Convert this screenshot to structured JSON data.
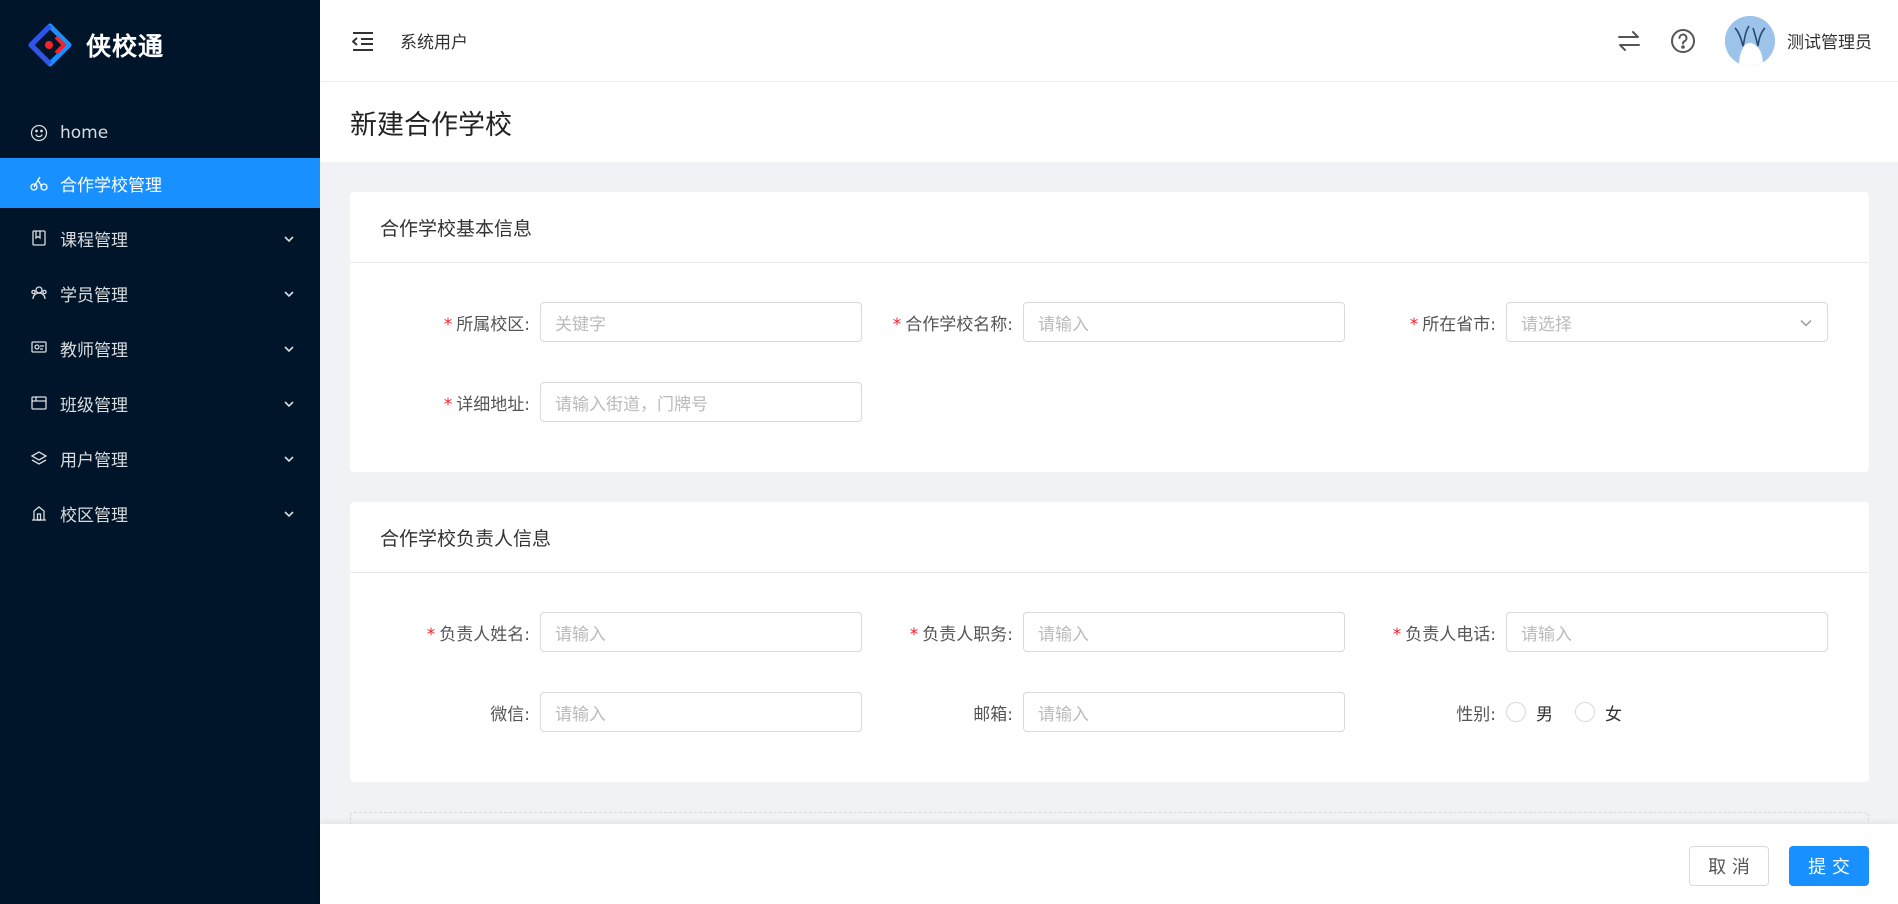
{
  "app": {
    "name": "侠校通"
  },
  "sidebar": {
    "items": [
      {
        "label": "home",
        "icon": "smile-icon",
        "active": false,
        "has_arrow": false
      },
      {
        "label": "合作学校管理",
        "icon": "bike-icon",
        "active": true,
        "has_arrow": false
      },
      {
        "label": "课程管理",
        "icon": "book-icon",
        "active": false,
        "has_arrow": true
      },
      {
        "label": "学员管理",
        "icon": "team-icon",
        "active": false,
        "has_arrow": true
      },
      {
        "label": "教师管理",
        "icon": "teacher-icon",
        "active": false,
        "has_arrow": true
      },
      {
        "label": "班级管理",
        "icon": "class-icon",
        "active": false,
        "has_arrow": true
      },
      {
        "label": "用户管理",
        "icon": "user-stack-icon",
        "active": false,
        "has_arrow": true
      },
      {
        "label": "校区管理",
        "icon": "campus-icon",
        "active": false,
        "has_arrow": true
      }
    ]
  },
  "header": {
    "title": "系统用户",
    "user_name": "测试管理员"
  },
  "page": {
    "title": "新建合作学校"
  },
  "section_basic": {
    "title": "合作学校基本信息",
    "fields": {
      "campus": {
        "label": "所属校区:",
        "placeholder": "关键字",
        "required": true
      },
      "school_name": {
        "label": "合作学校名称:",
        "placeholder": "请输入",
        "required": true
      },
      "province_city": {
        "label": "所在省市:",
        "placeholder": "请选择",
        "required": true
      },
      "address": {
        "label": "详细地址:",
        "placeholder": "请输入街道，门牌号",
        "required": true
      }
    }
  },
  "section_contact": {
    "title": "合作学校负责人信息",
    "fields": {
      "contact_name": {
        "label": "负责人姓名:",
        "placeholder": "请输入",
        "required": true
      },
      "contact_title": {
        "label": "负责人职务:",
        "placeholder": "请输入",
        "required": true
      },
      "contact_phone": {
        "label": "负责人电话:",
        "placeholder": "请输入",
        "required": true
      },
      "wechat": {
        "label": "微信:",
        "placeholder": "请输入",
        "required": false
      },
      "email": {
        "label": "邮箱:",
        "placeholder": "请输入",
        "required": false
      },
      "gender": {
        "label": "性别:",
        "options": [
          "男",
          "女"
        ],
        "required": false
      }
    }
  },
  "footer": {
    "cancel": "取 消",
    "submit": "提 交"
  },
  "colors": {
    "sidebar_bg": "#001529",
    "primary": "#1890ff",
    "required": "#f5222d"
  }
}
